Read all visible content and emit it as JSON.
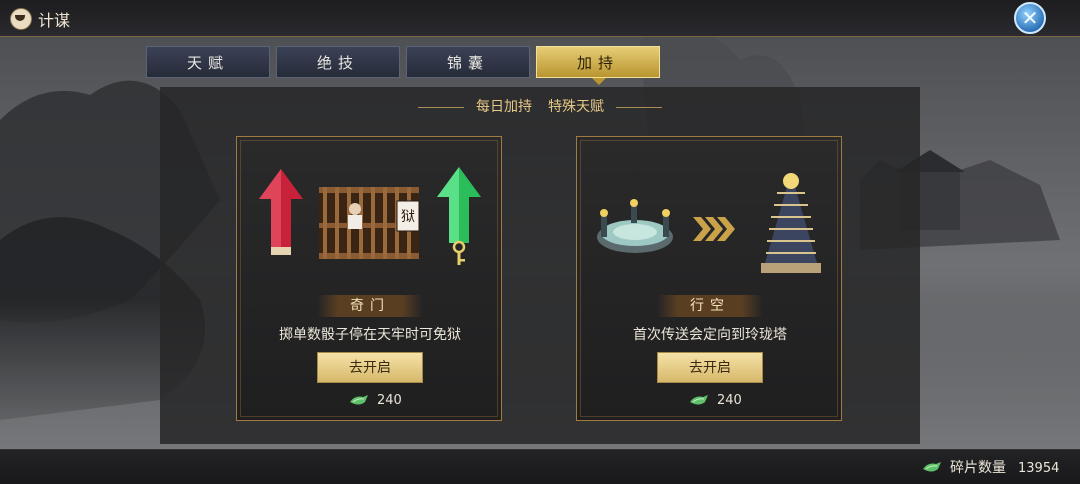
{
  "header": {
    "title": "计谋",
    "logo_icon": "mask-logo-icon",
    "close_icon": "crossed-swords-close-icon"
  },
  "tabs": [
    {
      "label": "天赋",
      "active": false
    },
    {
      "label": "绝技",
      "active": false
    },
    {
      "label": "锦囊",
      "active": false
    },
    {
      "label": "加持",
      "active": true
    }
  ],
  "panel": {
    "subtitle_left": "每日加持",
    "subtitle_right": "特殊天赋",
    "cards": [
      {
        "name": "奇门",
        "description": "掷单数骰子停在天牢时可免狱",
        "button": "去开启",
        "cost": "240",
        "art_icons": [
          "red-up-arrow-icon",
          "prison-cage-icon",
          "green-up-arrow-icon",
          "key-icon"
        ]
      },
      {
        "name": "行空",
        "description": "首次传送会定向到玲珑塔",
        "button": "去开启",
        "cost": "240",
        "art_icons": [
          "teleport-altar-icon",
          "chevron-right-icon",
          "pagoda-tower-icon"
        ]
      }
    ]
  },
  "footer": {
    "label": "碎片数量",
    "value": "13954",
    "icon": "jade-fragment-icon"
  },
  "colors": {
    "accent_gold": "#d9bd6e",
    "tab_inactive": "#2f3546",
    "panel_bg": "#262628",
    "card_border": "#a07a40"
  }
}
